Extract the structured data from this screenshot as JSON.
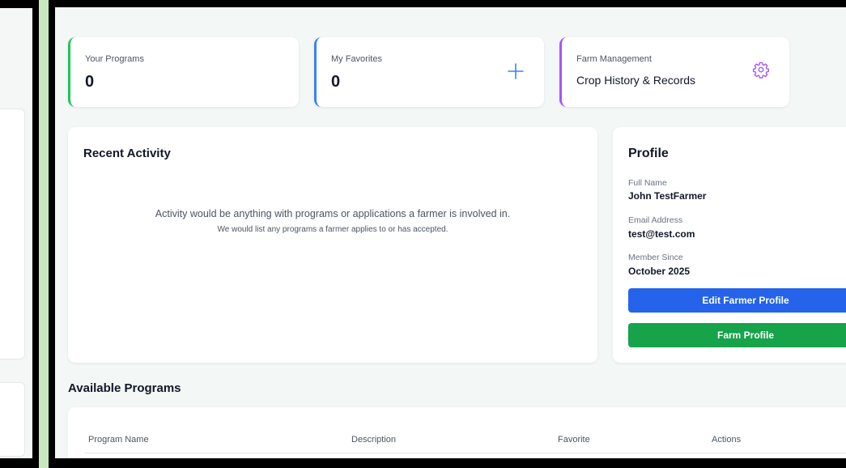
{
  "stats": {
    "programs": {
      "label": "Your Programs",
      "value": "0"
    },
    "favorites": {
      "label": "My Favorites",
      "value": "0",
      "icon": "plus-icon"
    },
    "farm": {
      "label": "Farm Management",
      "text": "Crop History & Records",
      "icon": "gear-icon"
    }
  },
  "activity": {
    "title": "Recent Activity",
    "message": "Activity would be anything with programs or applications a farmer is involved in.",
    "submessage": "We would list any programs a farmer applies to or has accepted."
  },
  "profile": {
    "title": "Profile",
    "full_name_label": "Full Name",
    "full_name": "John TestFarmer",
    "email_label": "Email Address",
    "email": "test@test.com",
    "member_label": "Member Since",
    "member_since": "October 2025",
    "edit_button": "Edit Farmer Profile",
    "farm_button": "Farm Profile"
  },
  "programs": {
    "title": "Available Programs",
    "columns": [
      "Program Name",
      "Description",
      "Favorite",
      "Actions"
    ]
  },
  "colors": {
    "green_accent": "#22c55e",
    "blue_accent": "#3b82f6",
    "purple_accent": "#a855f7",
    "primary_button": "#2563eb",
    "success_button": "#16a34a"
  }
}
